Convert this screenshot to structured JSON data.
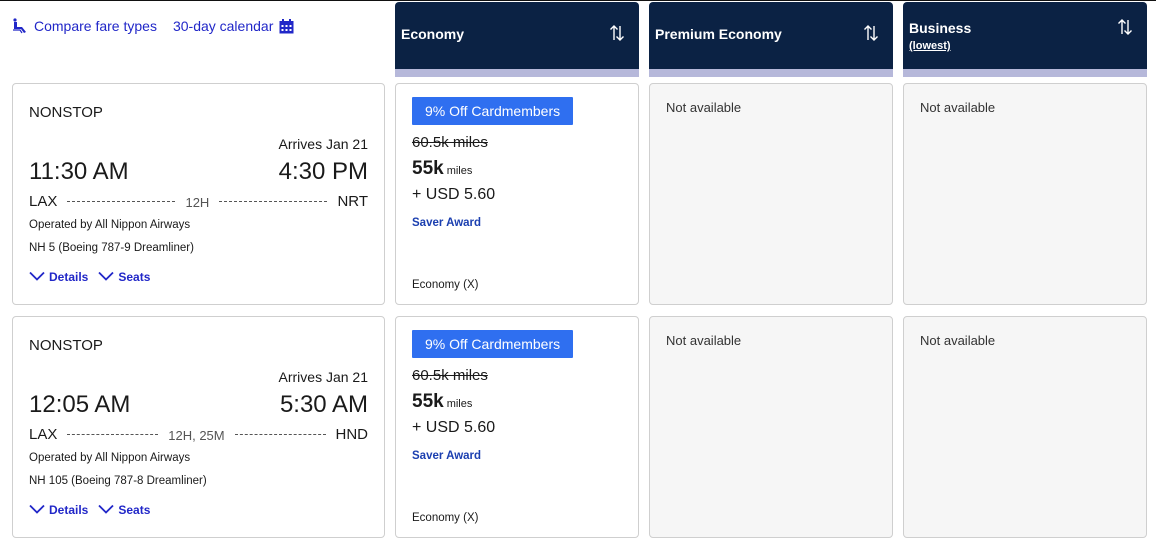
{
  "toolbar": {
    "compare_label": "Compare fare types",
    "compare_icon": "seat-icon",
    "calendar_label": "30-day calendar",
    "calendar_icon": "calendar-icon"
  },
  "columns": [
    {
      "title": "Economy",
      "subtitle": "",
      "sort_icon": "sort-icon"
    },
    {
      "title": "Premium Economy",
      "subtitle": "",
      "sort_icon": "sort-icon"
    },
    {
      "title": "Business",
      "subtitle": "(lowest)",
      "sort_icon": "sort-icon"
    }
  ],
  "colors": {
    "header_bg": "#0b2244",
    "header_bar": "#b6b8da",
    "link": "#2127c8",
    "promo_bg": "#2f6ff0",
    "award": "#1b3fb0",
    "na_bg": "#f6f6f6"
  },
  "flights": [
    {
      "stops": "NONSTOP",
      "arrives": "Arrives Jan 21",
      "depart_time": "11:30 AM",
      "arrive_time": "4:30 PM",
      "origin": "LAX",
      "destination": "NRT",
      "duration": "12H",
      "operated_by": "Operated by All Nippon Airways",
      "flight_number": "NH 5 (Boeing 787-9 Dreamliner)",
      "details_label": "Details",
      "seats_label": "Seats",
      "economy": {
        "promo": "9% Off Cardmembers",
        "original": "60.5k miles",
        "price": "55k",
        "price_unit": "miles",
        "fee": "+ USD 5.60",
        "award": "Saver Award",
        "cabin": "Economy (X)"
      },
      "premium_economy": "Not available",
      "business": "Not available"
    },
    {
      "stops": "NONSTOP",
      "arrives": "Arrives Jan 21",
      "depart_time": "12:05 AM",
      "arrive_time": "5:30 AM",
      "origin": "LAX",
      "destination": "HND",
      "duration": "12H, 25M",
      "operated_by": "Operated by All Nippon Airways",
      "flight_number": "NH 105 (Boeing 787-8 Dreamliner)",
      "details_label": "Details",
      "seats_label": "Seats",
      "economy": {
        "promo": "9% Off Cardmembers",
        "original": "60.5k miles",
        "price": "55k",
        "price_unit": "miles",
        "fee": "+ USD 5.60",
        "award": "Saver Award",
        "cabin": "Economy (X)"
      },
      "premium_economy": "Not available",
      "business": "Not available"
    }
  ]
}
